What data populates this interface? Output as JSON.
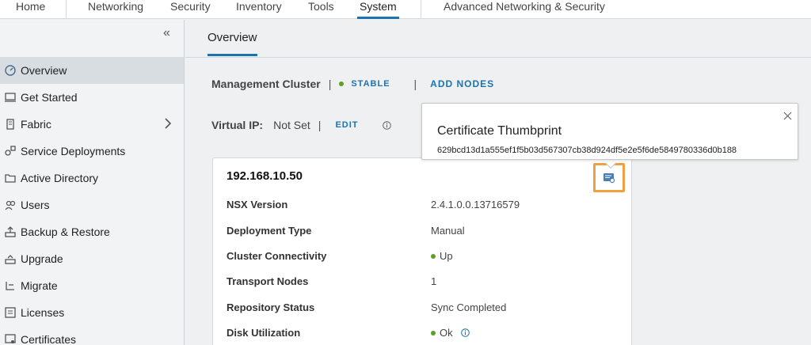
{
  "topnav": {
    "tabs": [
      "Home",
      "Networking",
      "Security",
      "Inventory",
      "Tools",
      "System",
      "Advanced Networking & Security"
    ],
    "active": "System"
  },
  "sidebar": {
    "items": [
      {
        "label": "Overview",
        "icon": "dashboard-icon"
      },
      {
        "label": "Get Started",
        "icon": "monitor-icon"
      },
      {
        "label": "Fabric",
        "icon": "server-icon"
      },
      {
        "label": "Service Deployments",
        "icon": "deploy-icon"
      },
      {
        "label": "Active Directory",
        "icon": "folder-icon"
      },
      {
        "label": "Users",
        "icon": "users-icon"
      },
      {
        "label": "Backup & Restore",
        "icon": "backup-icon"
      },
      {
        "label": "Upgrade",
        "icon": "upgrade-icon"
      },
      {
        "label": "Migrate",
        "icon": "migrate-icon"
      },
      {
        "label": "Licenses",
        "icon": "license-icon"
      },
      {
        "label": "Certificates",
        "icon": "certificate-icon"
      }
    ]
  },
  "main": {
    "tab": "Overview",
    "management_cluster_label": "Management Cluster",
    "cluster_status": "STABLE",
    "add_nodes": "ADD NODES",
    "virtual_ip_label": "Virtual IP:",
    "virtual_ip_value": "Not Set",
    "edit": "EDIT"
  },
  "node_card": {
    "title": "192.168.10.50",
    "rows": [
      {
        "key": "NSX Version",
        "value": "2.4.1.0.0.13716579"
      },
      {
        "key": "Deployment Type",
        "value": "Manual"
      },
      {
        "key": "Cluster Connectivity",
        "value": "Up"
      },
      {
        "key": "Transport Nodes",
        "value": "1"
      },
      {
        "key": "Repository Status",
        "value": "Sync Completed"
      },
      {
        "key": "Disk Utilization",
        "value": "Ok"
      }
    ]
  },
  "popover": {
    "title": "Certificate Thumbprint",
    "value": "629bcd13d1a555ef1f5b03d567307cb38d924df5e2e5f6de5849780336d0b188"
  },
  "colors": {
    "accent": "#1a73b3",
    "status_ok": "#5aa220",
    "highlight": "#f0a040"
  }
}
